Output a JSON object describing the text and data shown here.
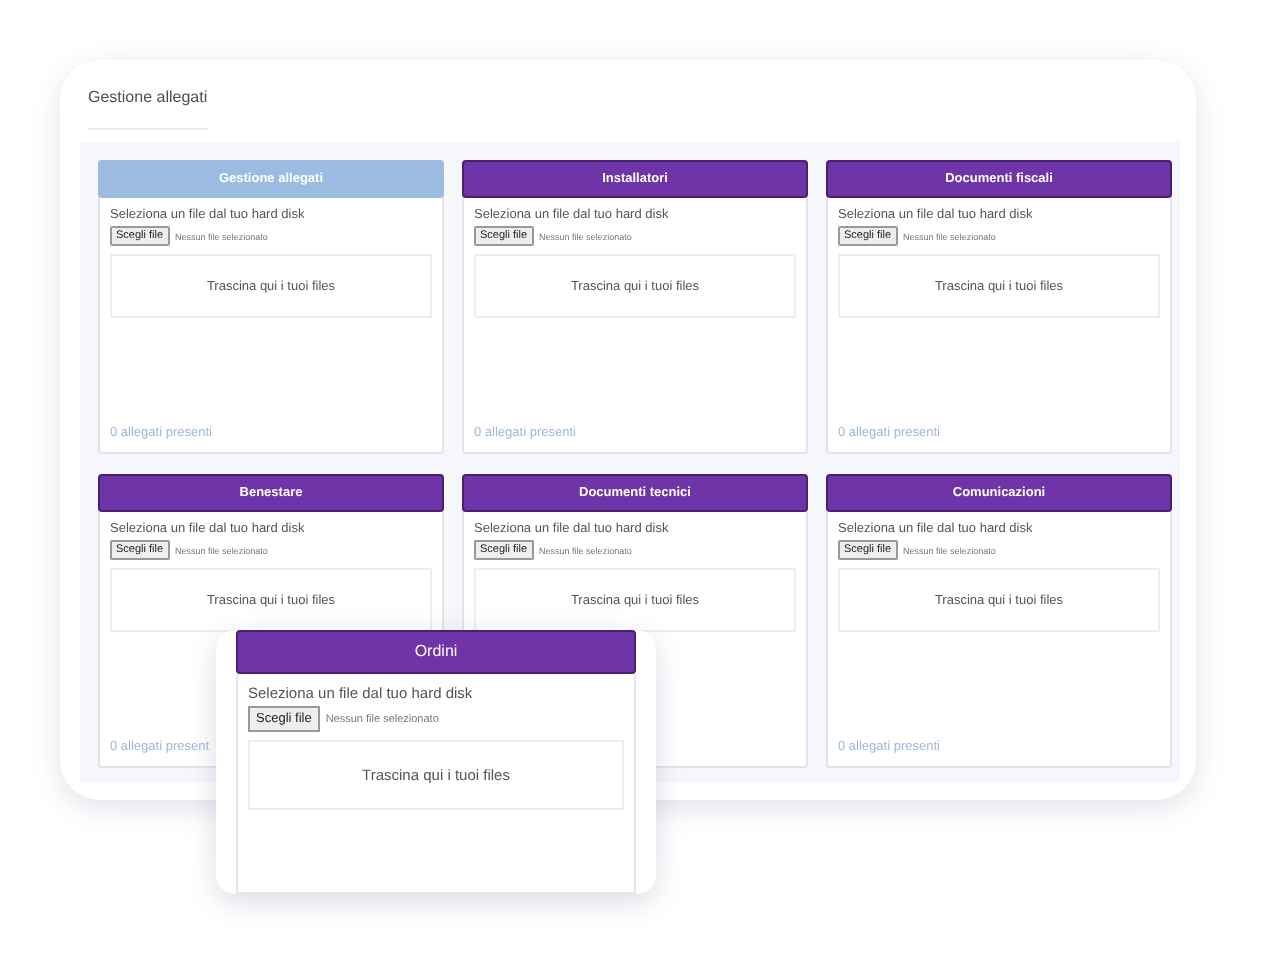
{
  "window": {
    "title": "Gestione allegati"
  },
  "cards": [
    {
      "title": "Gestione allegati",
      "selected": true,
      "prompt": "Seleziona un file dal tuo hard disk",
      "button": "Scegli file",
      "file_status": "Nessun file selezionato",
      "dropzone": "Trascina qui i tuoi files",
      "count": "0 allegati presenti"
    },
    {
      "title": "Installatori",
      "selected": false,
      "prompt": "Seleziona un file dal tuo hard disk",
      "button": "Scegli file",
      "file_status": "Nessun file selezionato",
      "dropzone": "Trascina qui i tuoi files",
      "count": "0 allegati presenti"
    },
    {
      "title": "Documenti fiscali",
      "selected": false,
      "prompt": "Seleziona un file dal tuo hard disk",
      "button": "Scegli file",
      "file_status": "Nessun file selezionato",
      "dropzone": "Trascina qui i tuoi files",
      "count": "0 allegati presenti"
    },
    {
      "title": "Benestare",
      "selected": false,
      "prompt": "Seleziona un file dal tuo hard disk",
      "button": "Scegli file",
      "file_status": "Nessun file selezionato",
      "dropzone": "Trascina qui i tuoi files",
      "count": "0 allegati present"
    },
    {
      "title": "Documenti tecnici",
      "selected": false,
      "prompt": "Seleziona un file dal tuo hard disk",
      "button": "Scegli file",
      "file_status": "Nessun file selezionato",
      "dropzone": "Trascina qui i tuoi files"
    },
    {
      "title": "Comunicazioni",
      "selected": false,
      "prompt": "Seleziona un file dal tuo hard disk",
      "button": "Scegli file",
      "file_status": "Nessun file selezionato",
      "dropzone": "Trascina qui i tuoi files",
      "count": "0 allegati presenti"
    }
  ],
  "popup_card": {
    "title": "Ordini",
    "selected": false,
    "prompt": "Seleziona un file dal tuo hard disk",
    "button": "Scegli file",
    "file_status": "Nessun file selezionato",
    "dropzone": "Trascina qui i tuoi files"
  }
}
